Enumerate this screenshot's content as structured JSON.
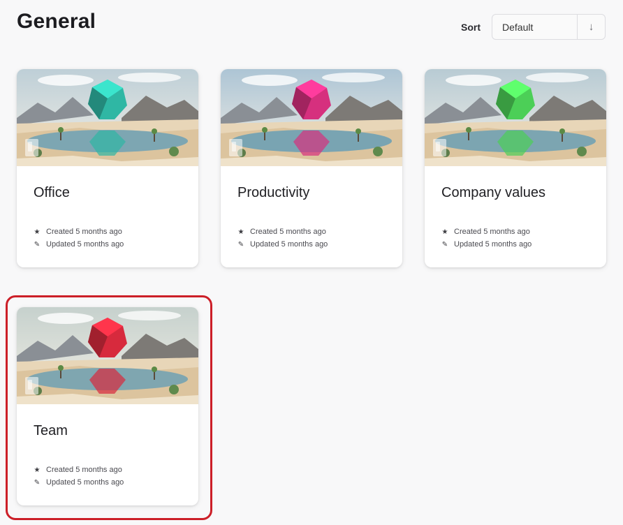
{
  "header": {
    "title": "General",
    "sort_label": "Sort",
    "sort_value": "Default",
    "sort_direction_icon": "arrow-down-icon"
  },
  "cards": [
    {
      "title": "Office",
      "created": "Created 5 months ago",
      "updated": "Updated 5 months ago",
      "gem_color": "#2fb7a4",
      "sky_color": "#cfe1ea"
    },
    {
      "title": "Productivity",
      "created": "Created 5 months ago",
      "updated": "Updated 5 months ago",
      "gem_color": "#d6307e",
      "sky_color": "#bcd6e8"
    },
    {
      "title": "Company values",
      "created": "Created 5 months ago",
      "updated": "Updated 5 months ago",
      "gem_color": "#4ccf57",
      "sky_color": "#c8dde6"
    },
    {
      "title": "Team",
      "created": "Created 5 months ago",
      "updated": "Updated 5 months ago",
      "gem_color": "#d72a3d",
      "sky_color": "#d7e3df"
    }
  ],
  "icons": {
    "created": "star-icon",
    "updated": "pencil-icon",
    "card_type": "document-icon"
  },
  "colors": {
    "highlight": "#cc1f28",
    "background": "#f8f8f9"
  }
}
